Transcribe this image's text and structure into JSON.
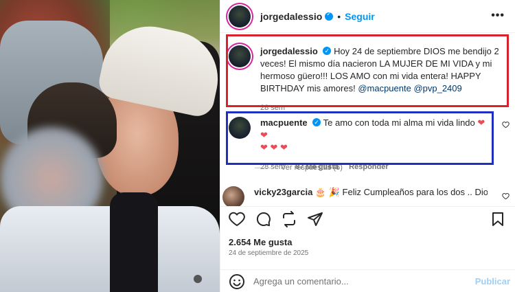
{
  "header": {
    "username": "jorgedalessio",
    "follow_label": "Seguir",
    "separator": "•",
    "more_label": "•••"
  },
  "caption": {
    "username": "jorgedalessio",
    "text": "Hoy 24 de septiembre DIOS me bendijo 2 veces! El mismo día nacieron LA MUJER DE MI VIDA y mi hermoso güero!!! LOS AMO con mi vida entera! HAPPY BIRTHDAY mis amores! ",
    "mentions": "@macpuente @pvp_2409",
    "time": "28 sem"
  },
  "comment": {
    "username": "macpuente",
    "text": "Te amo con toda mi alma mi vida lindo ",
    "hearts": "❤ ❤",
    "hearts2": "❤ ❤ ❤",
    "time": "28 sem",
    "likes": "87 Me gusta",
    "reply_label": "Responder"
  },
  "replies": {
    "label": "Ver respuestas (6)"
  },
  "comment2": {
    "username": "vicky23garcia",
    "text": "Feliz Cumpleaños para los dos .. Dios los bendiga"
  },
  "actions": {
    "likes": "2.654 Me gusta",
    "date": "24 de septiembre de 2025"
  },
  "add_comment": {
    "placeholder": "Agrega un comentario...",
    "publish_label": "Publicar"
  },
  "colors": {
    "caption_highlight": "#d8212b",
    "comment_highlight": "#1f2fbf",
    "link_blue": "#0095f6",
    "heart_red": "#ed4956"
  },
  "icons": [
    "heart-icon",
    "comment-icon",
    "share-icon",
    "send-icon",
    "bookmark-icon",
    "emoji-icon",
    "verified-icon",
    "more-icon"
  ]
}
